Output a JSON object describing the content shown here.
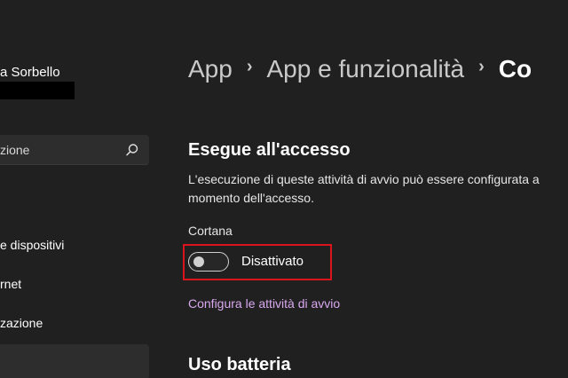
{
  "sidebar": {
    "user_name": "a Sorbello",
    "search": {
      "value": "zione",
      "icon": "search-icon"
    },
    "items": [
      {
        "label": "e dispositivi"
      },
      {
        "label": "rnet"
      },
      {
        "label": "zazione"
      },
      {
        "label": ""
      }
    ]
  },
  "breadcrumb": {
    "items": [
      "App",
      "App e funzionalità",
      "Co"
    ]
  },
  "main": {
    "section_title": "Esegue all'accesso",
    "description": "L'esecuzione di queste attività di avvio può essere configurata a momento dell'accesso.",
    "item_label": "Cortana",
    "toggle": {
      "state_label": "Disattivato",
      "on": false
    },
    "link_label": "Configura le attività di avvio",
    "section2_title": "Uso batteria"
  },
  "colors": {
    "background": "#202020",
    "highlight": "#d9141c",
    "link": "#d9a8ef"
  }
}
